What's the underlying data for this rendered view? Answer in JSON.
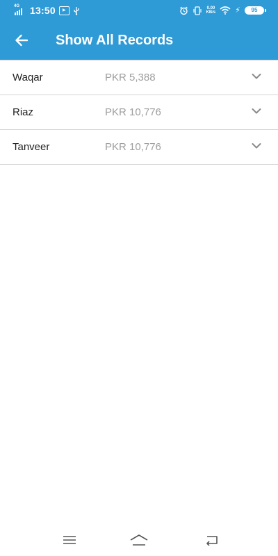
{
  "status_bar": {
    "network": "4G",
    "time": "13:50",
    "speed_top": "0.00",
    "speed_unit": "KB/s",
    "battery": "95"
  },
  "header": {
    "title": "Show All Records",
    "back_icon": "arrow-left-icon"
  },
  "records": [
    {
      "name": "Waqar",
      "amount": "PKR 5,388"
    },
    {
      "name": "Riaz",
      "amount": "PKR 10,776"
    },
    {
      "name": "Tanveer",
      "amount": "PKR 10,776"
    }
  ],
  "nav": {
    "menu_icon": "menu-icon",
    "home_icon": "home-icon",
    "back_icon": "back-icon"
  },
  "colors": {
    "primary": "#2e9ad6",
    "divider": "#d4d4d4",
    "amount_text": "#9e9e9e"
  }
}
